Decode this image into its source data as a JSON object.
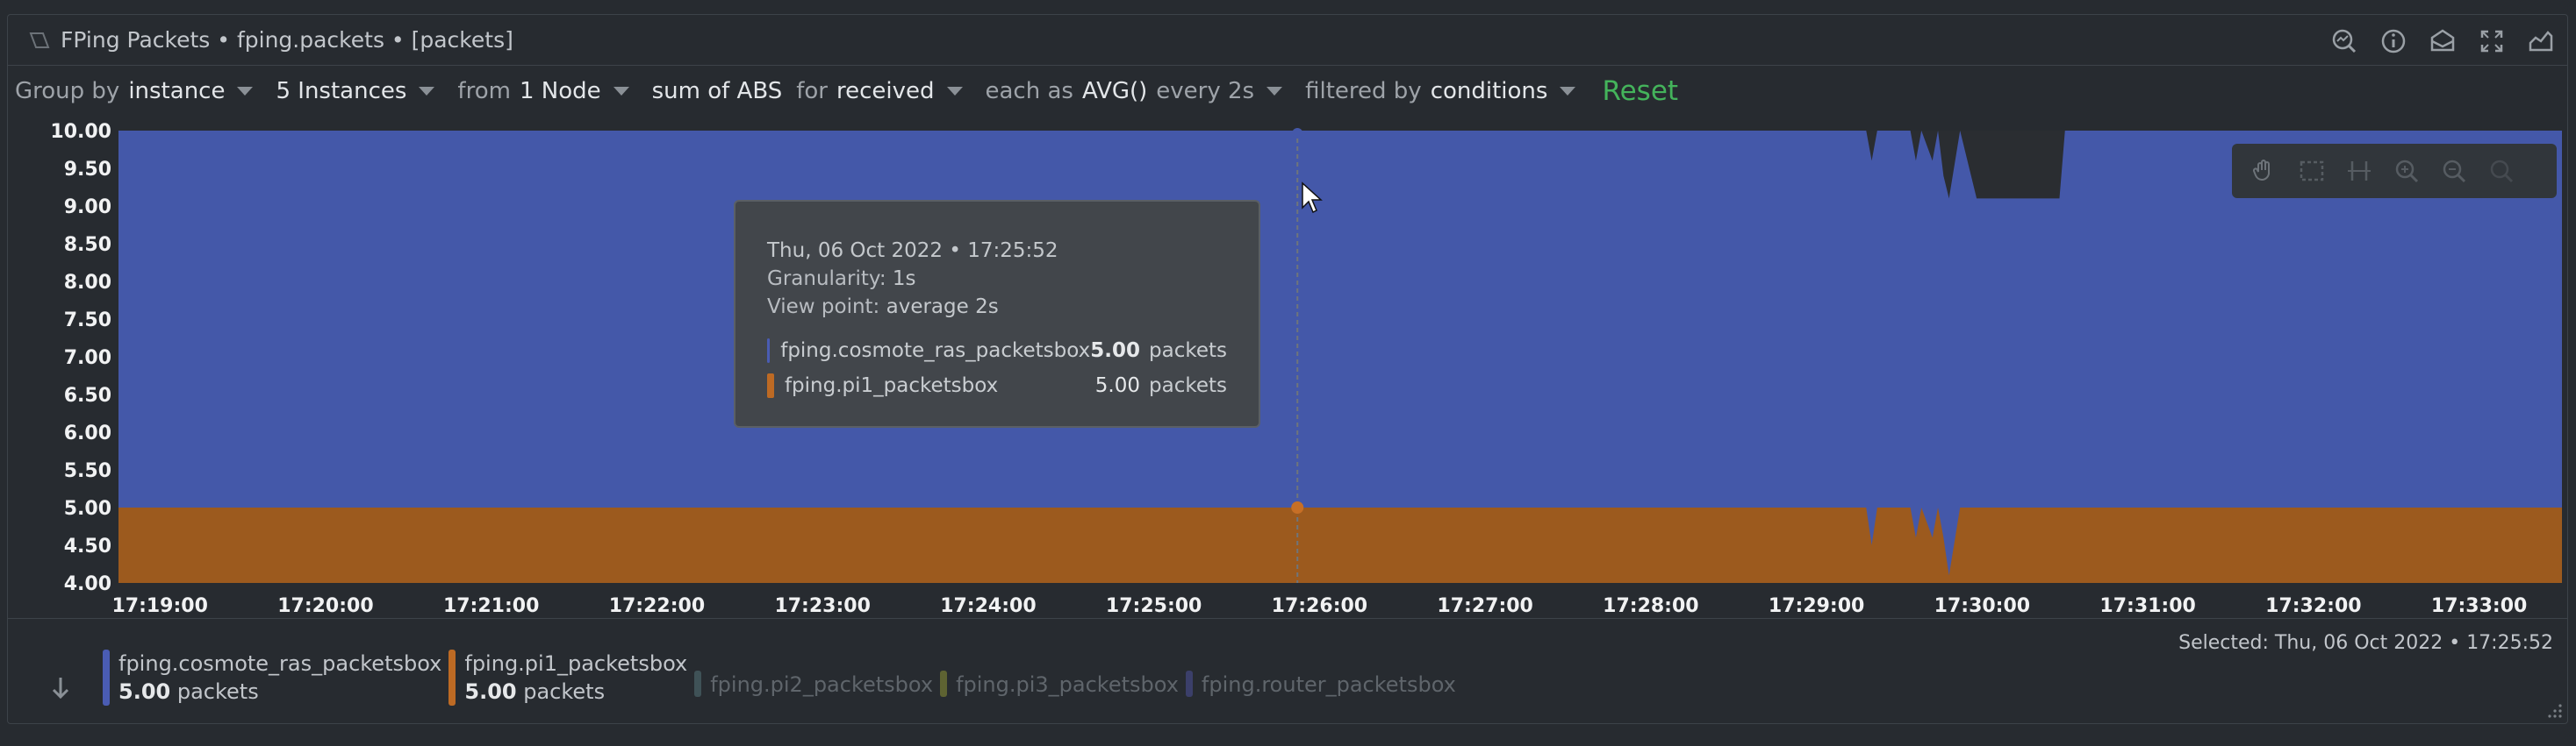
{
  "header": {
    "title": "FPing Packets • fping.packets • [packets]",
    "actions": [
      "chart-search-icon",
      "info-icon",
      "download-icon",
      "fullscreen-icon",
      "chart-type-icon"
    ]
  },
  "toolbar": {
    "group_by_label": "Group by",
    "group_by_value": "instance",
    "instances_value": "5 Instances",
    "from_label": "from",
    "nodes_value": "1 Node",
    "aggregation_value": "sum of ABS",
    "for_label": "for",
    "dimension_value": "received",
    "each_as_label": "each as",
    "time_agg_value": "AVG()",
    "every_value": "every 2s",
    "filtered_by_label": "filtered by",
    "filter_value": "conditions",
    "reset_label": "Reset"
  },
  "tooltip": {
    "timestamp": "Thu, 06 Oct 2022 • 17:25:52",
    "granularity_label": "Granularity:",
    "granularity_value": "1s",
    "view_point_label": "View point:",
    "view_point_value": "average 2s",
    "rows": [
      {
        "name": "fping.cosmote_ras_packetsbox",
        "value": "5.00",
        "unit": "packets",
        "color": "#4a5cb3"
      },
      {
        "name": "fping.pi1_packetsbox",
        "value": "5.00",
        "unit": "packets",
        "color": "#bd6a24"
      }
    ]
  },
  "toolbox": [
    "pan-hand-icon",
    "select-area-icon",
    "select-horizontal-icon",
    "zoom-in-icon",
    "zoom-out-icon",
    "zoom-reset-icon"
  ],
  "legend": {
    "selected_label": "Selected:",
    "selected_value": "Thu, 06 Oct 2022 • 17:25:52",
    "items": [
      {
        "name": "fping.cosmote_ras_packetsbox",
        "value": "5.00",
        "unit": "packets",
        "color": "#4a5cb3",
        "active": true
      },
      {
        "name": "fping.pi1_packetsbox",
        "value": "5.00",
        "unit": "packets",
        "color": "#bd6a24",
        "active": true
      },
      {
        "name": "fping.pi2_packetsbox",
        "color": "#3f5257",
        "active": false
      },
      {
        "name": "fping.pi3_packetsbox",
        "color": "#5e6332",
        "active": false
      },
      {
        "name": "fping.router_packetsbox",
        "color": "#3b3f6a",
        "active": false
      }
    ]
  },
  "chart_data": {
    "type": "area",
    "stacked": true,
    "title": "FPing Packets",
    "ylabel": "packets",
    "ylim": [
      4.0,
      10.0
    ],
    "yticks": [
      "10.00",
      "9.50",
      "9.00",
      "8.50",
      "8.00",
      "7.50",
      "7.00",
      "6.50",
      "6.00",
      "5.50",
      "5.00",
      "4.50",
      "4.00"
    ],
    "xticks": [
      "17:19:00",
      "17:20:00",
      "17:21:00",
      "17:22:00",
      "17:23:00",
      "17:24:00",
      "17:25:00",
      "17:26:00",
      "17:27:00",
      "17:28:00",
      "17:29:00",
      "17:30:00",
      "17:31:00",
      "17:32:00",
      "17:33:00"
    ],
    "x_range": [
      "17:18:45",
      "17:33:30"
    ],
    "cursor_x": "17:25:52",
    "series": [
      {
        "name": "fping.pi1_packetsbox",
        "color": "#9c5a1e",
        "points": [
          [
            "17:18:45",
            5.0
          ],
          [
            "17:29:18",
            5.0
          ],
          [
            "17:29:20",
            4.5
          ],
          [
            "17:29:22",
            5.0
          ],
          [
            "17:29:34",
            5.0
          ],
          [
            "17:29:36",
            4.6
          ],
          [
            "17:29:38",
            5.0
          ],
          [
            "17:29:42",
            4.6
          ],
          [
            "17:29:44",
            5.0
          ],
          [
            "17:29:46",
            4.6
          ],
          [
            "17:29:48",
            4.1
          ],
          [
            "17:29:52",
            5.0
          ],
          [
            "17:33:30",
            5.0
          ]
        ]
      },
      {
        "name": "fping.cosmote_ras_packetsbox",
        "color": "#4458a9",
        "points": [
          [
            "17:18:45",
            10.0
          ],
          [
            "17:29:18",
            10.0
          ],
          [
            "17:29:20",
            9.6
          ],
          [
            "17:29:22",
            10.0
          ],
          [
            "17:29:34",
            10.0
          ],
          [
            "17:29:36",
            9.6
          ],
          [
            "17:29:38",
            10.0
          ],
          [
            "17:29:42",
            9.6
          ],
          [
            "17:29:44",
            10.0
          ],
          [
            "17:29:46",
            9.4
          ],
          [
            "17:29:48",
            9.1
          ],
          [
            "17:29:52",
            10.0
          ],
          [
            "17:29:58",
            9.1
          ],
          [
            "17:30:28",
            9.1
          ],
          [
            "17:30:30",
            10.0
          ],
          [
            "17:33:30",
            10.0
          ]
        ]
      }
    ],
    "grid": false,
    "legend": "bottom"
  }
}
